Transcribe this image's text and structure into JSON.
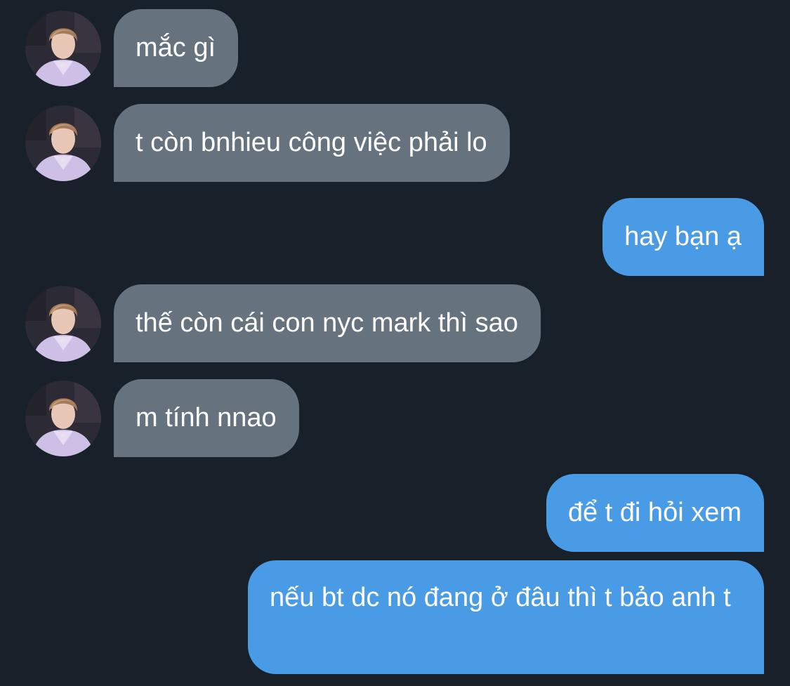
{
  "messages": [
    {
      "direction": "incoming",
      "text": "mắc gì"
    },
    {
      "direction": "incoming",
      "text": "t còn bnhieu công việc phải lo"
    },
    {
      "direction": "outgoing",
      "text": "hay bạn ạ"
    },
    {
      "direction": "incoming",
      "text": "thế còn cái con nyc mark thì sao"
    },
    {
      "direction": "incoming",
      "text": "m tính nnao"
    },
    {
      "direction": "outgoing",
      "text": "để t đi hỏi xem"
    },
    {
      "direction": "outgoing",
      "text": "nếu bt dc nó đang ở đâu thì t bảo anh t"
    }
  ],
  "colors": {
    "background": "#18202a",
    "incoming_bubble": "#66737f",
    "outgoing_bubble": "#4a9be6",
    "text": "#ffffff"
  },
  "avatar_icon": "profile-photo-icon"
}
